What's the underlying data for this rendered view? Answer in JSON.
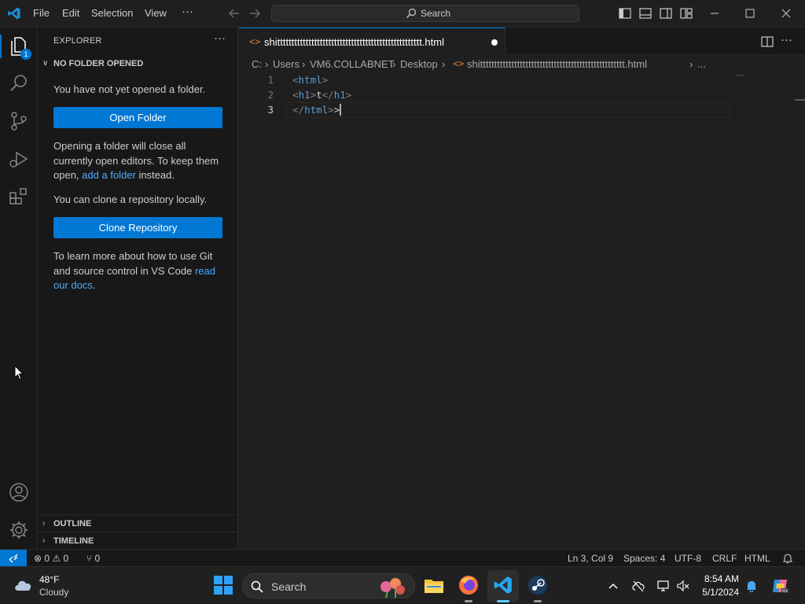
{
  "menu": [
    "File",
    "Edit",
    "Selection",
    "View",
    "···"
  ],
  "search": {
    "label": "Search"
  },
  "activity": {
    "explorer_badge": "1"
  },
  "sidebar": {
    "title": "EXPLORER",
    "more": "···",
    "section_title": "NO FOLDER OPENED",
    "no_folder_text": "You have not yet opened a folder.",
    "open_folder_button": "Open Folder",
    "closing_text_1": "Opening a folder will close all currently open editors. To keep them open, ",
    "add_folder_link": "add a folder",
    "closing_text_2": " instead.",
    "clone_text": "You can clone a repository locally.",
    "clone_button": "Clone Repository",
    "learn_text": "To learn more about how to use Git and source control in VS Code ",
    "read_docs_link": "read our docs",
    "learn_end": ".",
    "outline": "OUTLINE",
    "timeline": "TIMELINE"
  },
  "tab": {
    "filename": "shittttttttttttttttttttttttttttttttttttttttttttttttttt.html"
  },
  "breadcrumb": [
    "C:",
    "Users",
    "VM6.COLLABNET",
    "Desktop",
    "shittttttttttttttttttttttttttttttttttttttttttttttttttt.html",
    "..."
  ],
  "editor": {
    "lines": [
      {
        "num": "1",
        "open": "<",
        "tag": "html",
        "close": ">"
      },
      {
        "num": "2",
        "open": "<",
        "tag": "h1",
        "close": ">",
        "text": "t",
        "open2": "</",
        "tag2": "h1",
        "close2": ">"
      },
      {
        "num": "3",
        "open": "</",
        "tag": "html",
        "close": ">",
        "after": ">"
      }
    ]
  },
  "status": {
    "errors": "0",
    "warnings": "0",
    "ports": "0",
    "position": "Ln 3, Col 9",
    "spaces": "Spaces: 4",
    "encoding": "UTF-8",
    "eol": "CRLF",
    "language": "HTML"
  },
  "taskbar": {
    "temperature": "48°F",
    "weather": "Cloudy",
    "search": "Search",
    "time": "8:54 AM",
    "date": "5/1/2024"
  },
  "colors": {
    "accent": "#0078d4",
    "link": "#4daafc",
    "tag": "#569cd6",
    "bracket": "#808080"
  }
}
